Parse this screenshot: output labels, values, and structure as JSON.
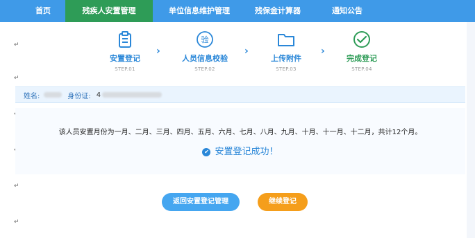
{
  "nav": {
    "items": [
      {
        "label": "首页"
      },
      {
        "label": "残疾人安置管理"
      },
      {
        "label": "单位信息维护管理"
      },
      {
        "label": "残保金计算器"
      },
      {
        "label": "通知公告"
      }
    ]
  },
  "steps": [
    {
      "title": "安置登记",
      "sub": "STEP.01",
      "icon": "clipboard-icon"
    },
    {
      "title": "人员信息校验",
      "sub": "STEP.02",
      "icon": "verify-icon"
    },
    {
      "title": "上传附件",
      "sub": "STEP.03",
      "icon": "folder-icon"
    },
    {
      "title": "完成登记",
      "sub": "STEP.04",
      "icon": "check-circle-icon"
    }
  ],
  "info": {
    "name_label": "姓名:",
    "id_label": "身份证:",
    "id_value": "4"
  },
  "result": {
    "month_text": "该人员安置月份为一月、二月、三月、四月、五月、六月、七月、八月、九月、十月、十一月、十二月，共计12个月。",
    "success_text": "安置登记成功！"
  },
  "buttons": {
    "back": "返回安置登记管理",
    "continue": "继续登记"
  },
  "colors": {
    "nav_bg": "#3f9ae8",
    "nav_active": "#2e9c57",
    "primary": "#2a87d8",
    "success": "#2e9c57",
    "orange": "#f59e1b"
  },
  "paragraph_mark": "↵"
}
